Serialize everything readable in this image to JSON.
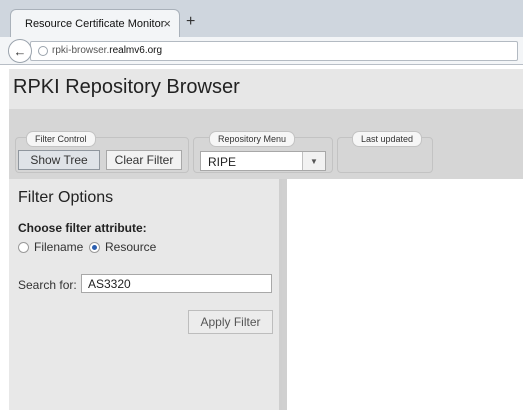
{
  "browser": {
    "tab_title": "Resource Certificate Monitor",
    "close_glyph": "×",
    "new_tab_glyph": "+",
    "back_glyph": "←",
    "url_prefix": "rpki-browser.",
    "url_domain": "realmv6.org"
  },
  "app": {
    "title": "RPKI Repository Browser"
  },
  "filter_control": {
    "legend": "Filter Control",
    "show_tree_label": "Show Tree",
    "clear_filter_label": "Clear Filter"
  },
  "repository_menu": {
    "legend": "Repository Menu",
    "selected": "RIPE",
    "arrow_glyph": "▼"
  },
  "last_updated": {
    "legend": "Last updated"
  },
  "filter_options": {
    "heading": "Filter Options",
    "choose_label": "Choose filter attribute:",
    "options": [
      {
        "label": "Filename",
        "checked": false
      },
      {
        "label": "Resource",
        "checked": true
      }
    ],
    "search_label": "Search for:",
    "search_value": "AS3320",
    "apply_label": "Apply Filter"
  },
  "colors": {
    "toolbar_bg": "#d6d6d6",
    "sidebar_bg": "#e8e8e8",
    "radio_accent": "#2b5fb0"
  }
}
